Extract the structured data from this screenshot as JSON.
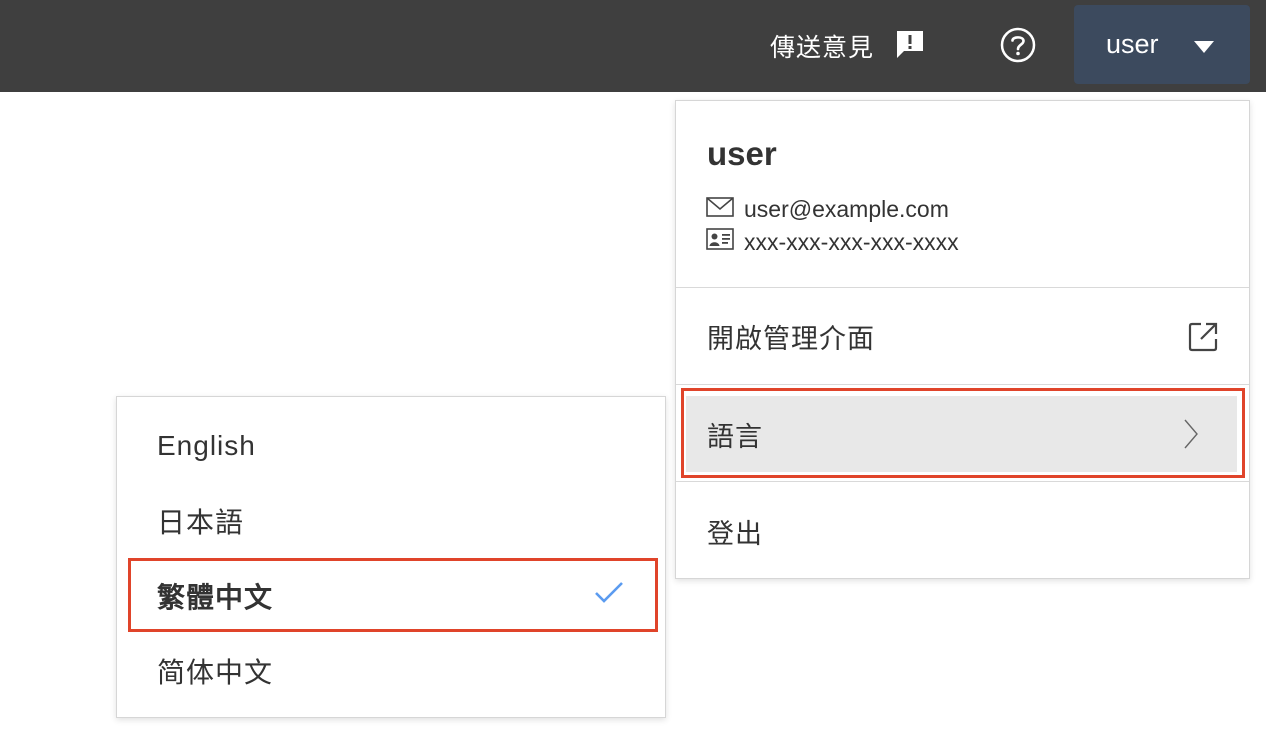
{
  "header": {
    "feedback_label": "傳送意見",
    "feedback_icon": "feedback-bubble-icon",
    "help_icon": "help-circle-icon",
    "user_button_label": "user",
    "user_button_icon": "caret-down-icon"
  },
  "user_menu": {
    "name": "user",
    "email": "user@example.com",
    "account_id": "xxx-xxx-xxx-xxx-xxxx",
    "items": [
      {
        "label": "開啟管理介面",
        "icon": "external-link-icon"
      },
      {
        "label": "語言",
        "icon": "chevron-right-icon"
      },
      {
        "label": "登出"
      }
    ]
  },
  "language_menu": {
    "options": [
      {
        "label": "English"
      },
      {
        "label": "日本語"
      },
      {
        "label": "繁體中文",
        "selected": true
      },
      {
        "label": "简体中文"
      }
    ],
    "check_icon": "checkmark-icon"
  },
  "colors": {
    "topbar": "#3f3f3f",
    "user_button": "#3c4a5e",
    "highlight": "#e0442a",
    "hover_bg": "#e8e8e8",
    "check": "#5b9bf0"
  }
}
